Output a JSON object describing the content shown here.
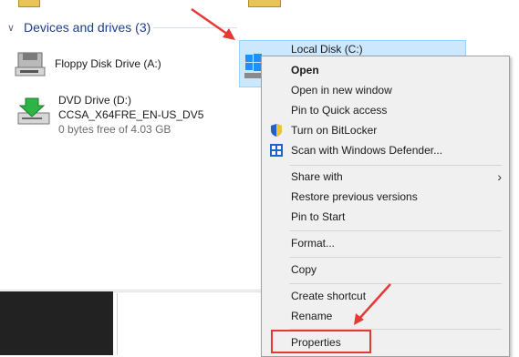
{
  "section": {
    "title": "Devices and drives (3)"
  },
  "drives": {
    "floppy": {
      "name": "Floppy Disk Drive (A:)"
    },
    "dvd": {
      "name": "DVD Drive (D:)",
      "label": "CCSA_X64FRE_EN-US_DV5",
      "space": "0 bytes free of 4.03 GB"
    },
    "local": {
      "name": "Local Disk (C:)"
    }
  },
  "context_menu": {
    "items": [
      {
        "label": "Open",
        "bold": true,
        "icon": ""
      },
      {
        "label": "Open in new window",
        "icon": ""
      },
      {
        "label": "Pin to Quick access",
        "icon": ""
      },
      {
        "label": "Turn on BitLocker",
        "icon": "shield-icon"
      },
      {
        "label": "Scan with Windows Defender...",
        "icon": "windows-defender-icon"
      },
      {
        "label": "Share with",
        "icon": "",
        "submenu": true
      },
      {
        "label": "Restore previous versions",
        "icon": ""
      },
      {
        "label": "Pin to Start",
        "icon": ""
      },
      {
        "label": "Format...",
        "icon": ""
      },
      {
        "label": "Copy",
        "icon": ""
      },
      {
        "label": "Create shortcut",
        "icon": ""
      },
      {
        "label": "Rename",
        "icon": ""
      },
      {
        "label": "Properties",
        "icon": "",
        "highlighted": true
      }
    ]
  },
  "colors": {
    "selection_bg": "#cce8ff",
    "selection_border": "#99d1ff",
    "header_text": "#1e3f8c",
    "annotation": "#e53935"
  }
}
